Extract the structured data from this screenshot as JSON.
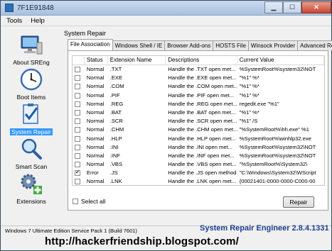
{
  "window": {
    "title": "7F1E91848"
  },
  "menu": [
    "Tools",
    "Help"
  ],
  "sidebar": [
    {
      "label": "About SREng",
      "icon": "computer-icon"
    },
    {
      "label": "Boot Items",
      "icon": "clock-icon"
    },
    {
      "label": "System Repair",
      "icon": "checklist-icon",
      "active": true
    },
    {
      "label": "Smart Scan",
      "icon": "magnifier-icon"
    },
    {
      "label": "Extensions",
      "icon": "gears-icon"
    }
  ],
  "main": {
    "title": "System Repair",
    "tabs": [
      "File Association",
      "Windows Shell / IE",
      "Browser Add-ons",
      "HOSTS File",
      "Winsock Provider",
      "Advanced Repair"
    ],
    "columns": [
      "",
      "Status",
      "Extension Name",
      "Descriptions",
      "Current Value"
    ],
    "rows": [
      {
        "checked": false,
        "status": "Normal",
        "ext": ".TXT",
        "desc": "Handle the .TXT open met...",
        "value": "%SystemRoot%\\system32\\NOT"
      },
      {
        "checked": false,
        "status": "Normal",
        "ext": ".EXE",
        "desc": "Handle the .EXE open met...",
        "value": "\"%1\" %*"
      },
      {
        "checked": false,
        "status": "Normal",
        "ext": ".COM",
        "desc": "Handle the .COM open met...",
        "value": "\"%1\" %*"
      },
      {
        "checked": false,
        "status": "Normal",
        "ext": ".PIF",
        "desc": "Handle the .PIF open met...",
        "value": "\"%1\" %*"
      },
      {
        "checked": false,
        "status": "Normal",
        "ext": ".REG",
        "desc": "Handle the .REG open met...",
        "value": "regedit.exe \"%1\""
      },
      {
        "checked": false,
        "status": "Normal",
        "ext": ".BAT",
        "desc": "Handle the .BAT open met...",
        "value": "\"%1\" %*"
      },
      {
        "checked": false,
        "status": "Normal",
        "ext": ".SCR",
        "desc": "Handle the .SCR open met...",
        "value": "\"%1\" /S"
      },
      {
        "checked": false,
        "status": "Normal",
        "ext": ".CHM",
        "desc": "Handle the .CHM open met...",
        "value": "\"%SystemRoot%\\hh.exe\" %1"
      },
      {
        "checked": false,
        "status": "Normal",
        "ext": ".HLP",
        "desc": "Handle the .HLP open met...",
        "value": "%SystemRoot%\\winhlp32.exe"
      },
      {
        "checked": false,
        "status": "Normal",
        "ext": ".INI",
        "desc": "Handle the .INI open met...",
        "value": "%SystemRoot%\\system32\\NOT"
      },
      {
        "checked": false,
        "status": "Normal",
        "ext": ".INF",
        "desc": "Handle the .INF open met...",
        "value": "%SystemRoot%\\system32\\NOT"
      },
      {
        "checked": false,
        "status": "Normal",
        "ext": ".VBS",
        "desc": "Handle the .VBS open met...",
        "value": "\"%SystemRoot%\\System32\\"
      },
      {
        "checked": true,
        "status": "Error",
        "ext": ".JS",
        "desc": "Handle the .JS open method",
        "value": "\"C:\\Windows\\System32\\WScript"
      },
      {
        "checked": false,
        "status": "Normal",
        "ext": ".LNK",
        "desc": "Handle the .LNK open met...",
        "value": "{00021401-0000-0000-C000-00"
      }
    ],
    "select_all": "Select all",
    "repair": "Repair"
  },
  "status": "Windows 7 Ultimate Edition Service Pack 1 (Build 7601)",
  "brand": "System Repair Engineer 2.8.4.1331",
  "watermark": "http://hackerfriendship.blogspot.com/"
}
